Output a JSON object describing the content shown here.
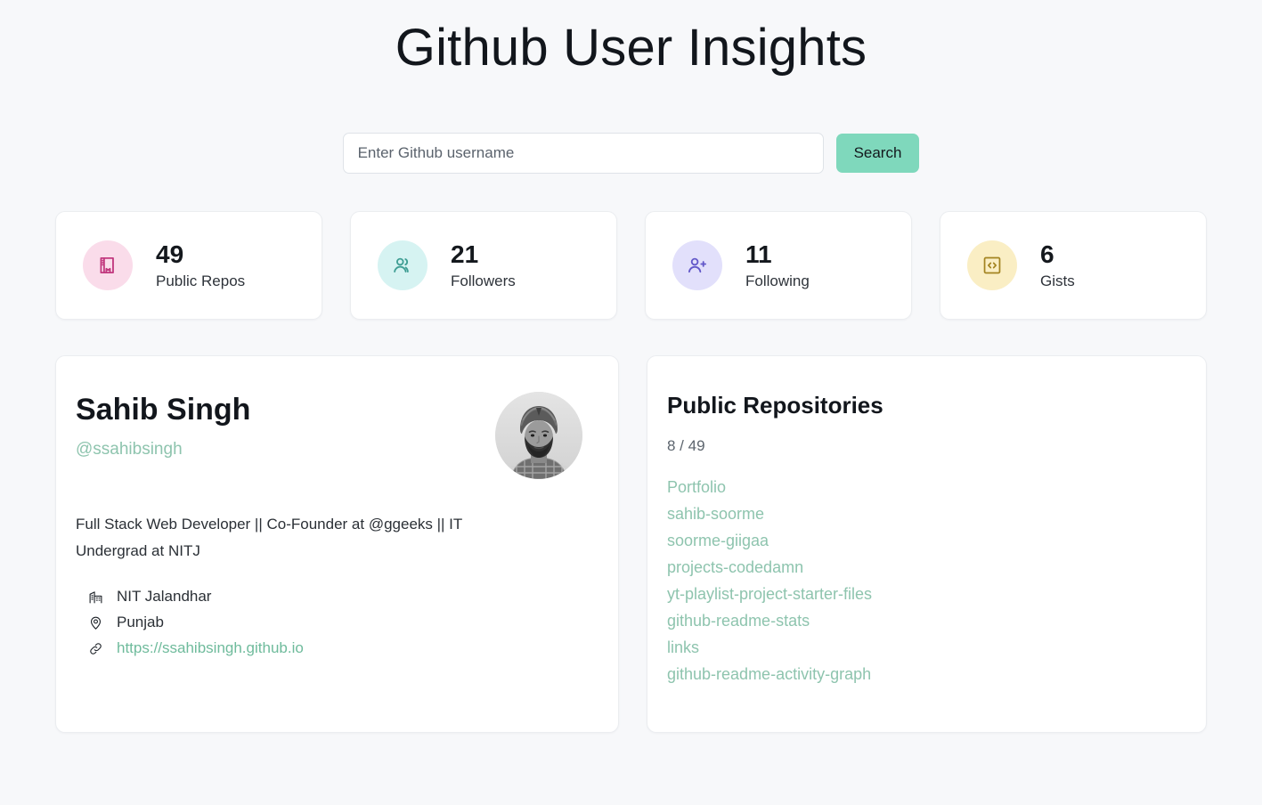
{
  "header": {
    "title": "Github User Insights"
  },
  "search": {
    "placeholder": "Enter Github username",
    "value": "",
    "button_label": "Search"
  },
  "stats": [
    {
      "value": "49",
      "label": "Public Repos",
      "icon": "repo-book-icon",
      "icon_bg": "#fadcea",
      "icon_color": "#c2397f"
    },
    {
      "value": "21",
      "label": "Followers",
      "icon": "users-icon",
      "icon_bg": "#d6f3f2",
      "icon_color": "#3f9e94"
    },
    {
      "value": "11",
      "label": "Following",
      "icon": "user-plus-icon",
      "icon_bg": "#e2e0fb",
      "icon_color": "#6258c9"
    },
    {
      "value": "6",
      "label": "Gists",
      "icon": "code-brackets-icon",
      "icon_bg": "#faeec4",
      "icon_color": "#a38320"
    }
  ],
  "profile": {
    "name": "Sahib Singh",
    "handle": "@ssahibsingh",
    "bio": "Full Stack Web Developer || Co-Founder at @ggeeks || IT Undergrad at NITJ",
    "avatar_alt": "avatar",
    "details": [
      {
        "icon": "building-icon",
        "text": "NIT Jalandhar",
        "is_link": false
      },
      {
        "icon": "map-pin-icon",
        "text": "Punjab",
        "is_link": false
      },
      {
        "icon": "link-icon",
        "text": "https://ssahibsingh.github.io",
        "is_link": true
      }
    ]
  },
  "repositories": {
    "title": "Public Repositories",
    "count_text": "8 / 49",
    "items": [
      "Portfolio",
      "sahib-soorme",
      "soorme-giigaa",
      "projects-codedamn",
      "yt-playlist-project-starter-files",
      "github-readme-stats",
      "links",
      "github-readme-activity-graph"
    ]
  },
  "colors": {
    "page_background": "#f7f8fa",
    "card_background": "#ffffff",
    "accent_button": "#7fd8bc",
    "link_green": "#8ec4ae",
    "text_dark": "#12161c",
    "text_muted": "#5c646d"
  }
}
